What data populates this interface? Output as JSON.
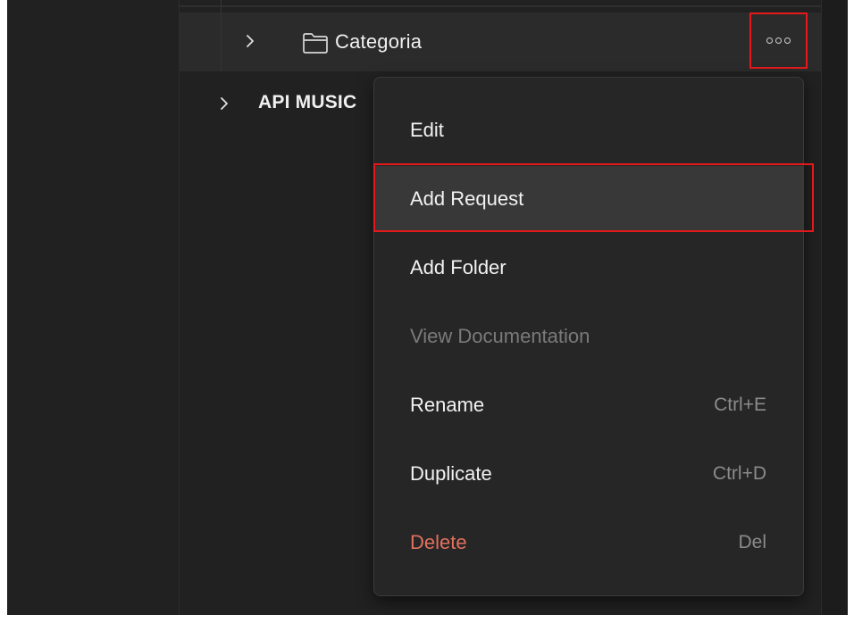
{
  "tree": {
    "folder": {
      "label": "Categoria",
      "icon": "folder-icon",
      "expand_icon": "chevron-right-icon",
      "more_icon": "more-horizontal-icon"
    },
    "collection": {
      "label": "API MUSIC",
      "expand_icon": "chevron-right-icon"
    }
  },
  "context_menu": {
    "items": [
      {
        "label": "Edit",
        "shortcut": ""
      },
      {
        "label": "Add Request",
        "shortcut": "",
        "state": "hovered"
      },
      {
        "label": "Add Folder",
        "shortcut": ""
      },
      {
        "label": "View Documentation",
        "shortcut": "",
        "state": "disabled"
      },
      {
        "label": "Rename",
        "shortcut": "Ctrl+E"
      },
      {
        "label": "Duplicate",
        "shortcut": "Ctrl+D"
      },
      {
        "label": "Delete",
        "shortcut": "Del",
        "state": "danger"
      }
    ]
  },
  "colors": {
    "highlight_outline": "#e5191c",
    "delete_text": "#e2705e",
    "menu_bg": "#262626",
    "hover_bg": "#383838"
  }
}
